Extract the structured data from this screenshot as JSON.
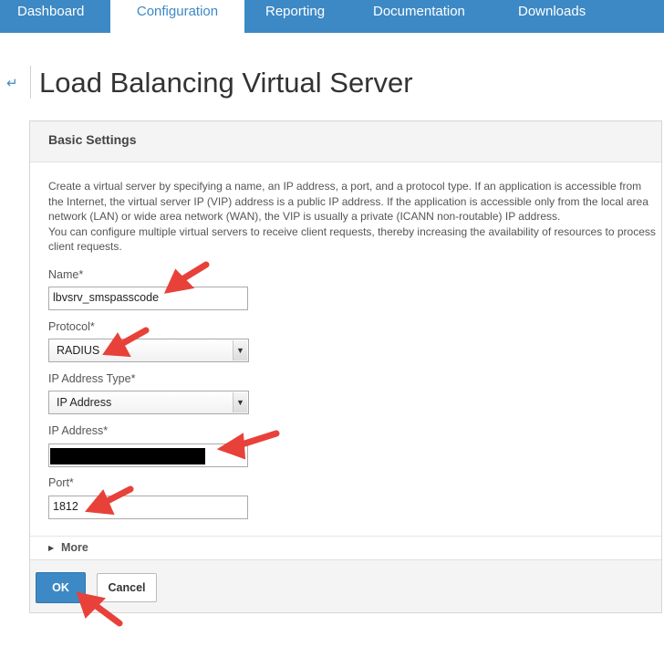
{
  "nav": {
    "tabs": [
      {
        "label": "Dashboard"
      },
      {
        "label": "Configuration"
      },
      {
        "label": "Reporting"
      },
      {
        "label": "Documentation"
      },
      {
        "label": "Downloads"
      }
    ],
    "active": "Configuration"
  },
  "page": {
    "back_icon": "back-arrow-icon",
    "title": "Load Balancing Virtual Server"
  },
  "panel": {
    "header": "Basic Settings",
    "description": [
      "Create a virtual server by specifying a name, an IP address, a port, and a protocol type. If an application is accessible from the Internet, the virtual server IP (VIP) address is a public IP address. If the application is accessible only from the local area network (LAN) or wide area network (WAN), the VIP is usually a private (ICANN non-routable) IP address.",
      "You can configure multiple virtual servers to receive client requests, thereby increasing the availability of resources to process client requests."
    ],
    "fields": {
      "name": {
        "label": "Name*",
        "value": "lbvsrv_smspasscode"
      },
      "protocol": {
        "label": "Protocol*",
        "value": "RADIUS"
      },
      "ip_address_type": {
        "label": "IP Address Type*",
        "value": "IP Address"
      },
      "ip_address": {
        "label": "IP Address*",
        "value": ""
      },
      "port": {
        "label": "Port*",
        "value": "1812"
      }
    },
    "more_label": "More",
    "buttons": {
      "ok": "OK",
      "cancel": "Cancel"
    }
  },
  "annotation": {
    "arrow_color": "#e8413a"
  },
  "colors": {
    "brand": "#3d89c5"
  }
}
